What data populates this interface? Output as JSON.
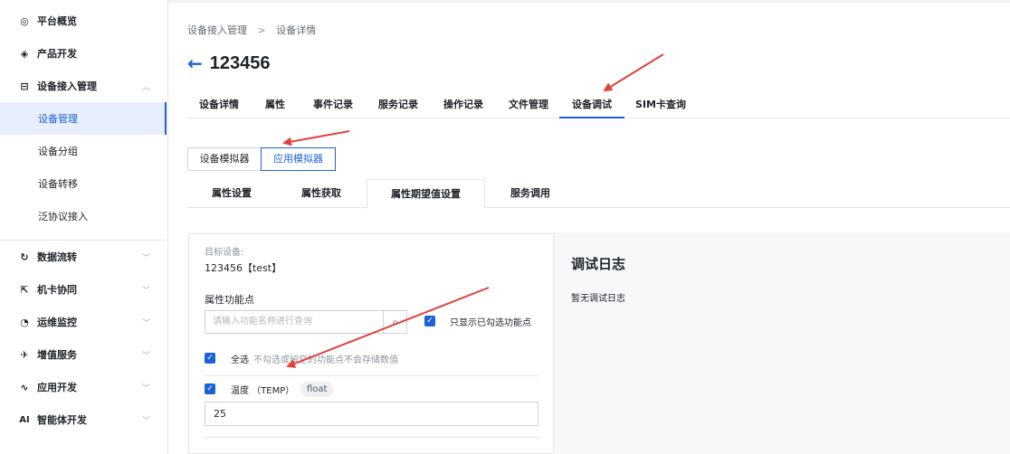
{
  "sidebar": {
    "items": [
      {
        "label": "平台概览",
        "icon": "overview-icon",
        "glyph": "◎"
      },
      {
        "label": "产品开发",
        "icon": "product-icon",
        "glyph": "◈"
      },
      {
        "label": "设备接入管理",
        "icon": "device-access-icon",
        "glyph": "⊟",
        "expanded": true
      },
      {
        "label": "数据流转",
        "icon": "data-flow-icon",
        "glyph": "↻"
      },
      {
        "label": "机卡协同",
        "icon": "sim-collab-icon",
        "glyph": "⇱"
      },
      {
        "label": "运维监控",
        "icon": "monitor-icon",
        "glyph": "◔"
      },
      {
        "label": "增值服务",
        "icon": "value-added-icon",
        "glyph": "✈"
      },
      {
        "label": "应用开发",
        "icon": "app-dev-icon",
        "glyph": "∿"
      },
      {
        "label": "智能体开发",
        "icon": "ai-icon",
        "glyph": "AI"
      }
    ],
    "sub_items": [
      {
        "label": "设备管理",
        "active": true
      },
      {
        "label": "设备分组"
      },
      {
        "label": "设备转移"
      },
      {
        "label": "泛协议接入"
      }
    ]
  },
  "breadcrumb": {
    "parent": "设备接入管理",
    "separator": ">",
    "current": "设备详情"
  },
  "page": {
    "back_glyph": "←",
    "title": "123456"
  },
  "tabs": [
    "设备详情",
    "属性",
    "事件记录",
    "服务记录",
    "操作记录",
    "文件管理",
    "设备调试",
    "SIM卡查询"
  ],
  "active_tab": "设备调试",
  "simulator_buttons": [
    "设备模拟器",
    "应用模拟器"
  ],
  "active_simulator": "应用模拟器",
  "subtabs": [
    "属性设置",
    "属性获取",
    "属性期望值设置",
    "服务调用"
  ],
  "active_subtab": "属性期望值设置",
  "form": {
    "target_label": "目标设备:",
    "target_value": "123456【test】",
    "feature_label": "属性功能点",
    "search_placeholder": "请输入功能名称进行查询",
    "show_checked_label": "只显示已勾选功能点",
    "select_all_label": "全选",
    "select_all_hint": "不勾选或留空的功能点不会存储数值",
    "property_label": "温度 （TEMP）",
    "property_type": "float",
    "property_value": "25"
  },
  "log": {
    "title": "调试日志",
    "empty_text": "暂无调试日志"
  },
  "colors": {
    "accent": "#1a62d6",
    "annotation_arrow": "#e0413b",
    "active_bg": "#e8eefb"
  }
}
